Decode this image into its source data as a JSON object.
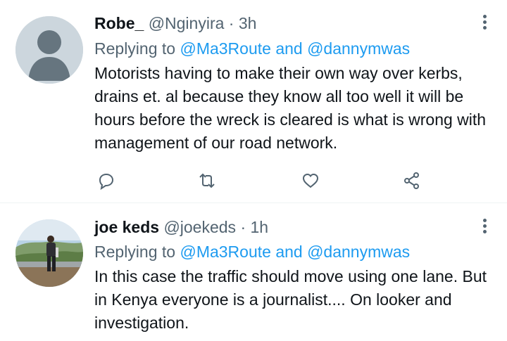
{
  "tweets": [
    {
      "name": "Robe_",
      "handle": "@Nginyira",
      "separator": "·",
      "time": "3h",
      "replying_prefix": "Replying to",
      "replying_mentions": "@Ma3Route and @dannymwas",
      "text": "Motorists having to make their own way over kerbs, drains et. al because they know all too well it will be hours before the wreck is cleared is what is wrong with management of our road network.",
      "actions": [
        "reply-icon",
        "retweet-icon",
        "like-icon",
        "share-icon"
      ]
    },
    {
      "name": "joe keds",
      "handle": "@joekeds",
      "separator": "·",
      "time": "1h",
      "replying_prefix": "Replying to",
      "replying_mentions": "@Ma3Route and @dannymwas",
      "text": "In this case the traffic should move using one lane. But in Kenya everyone is a journalist.... On looker and investigation."
    }
  ],
  "colors": {
    "text_primary": "#0f1419",
    "text_secondary": "#536471",
    "accent": "#1d9bf0",
    "divider": "#eff3f4"
  }
}
